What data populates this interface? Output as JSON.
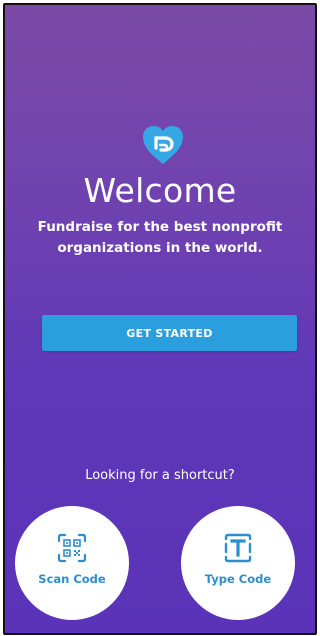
{
  "welcome": {
    "title": "Welcome",
    "subtitle_line1": "Fundraise for the best nonprofit",
    "subtitle_line2": "organizations in the world.",
    "logo_icon": "heart-logo-icon"
  },
  "cta": {
    "get_started_label": "GET STARTED",
    "color": "#2b9fde"
  },
  "shortcuts": {
    "prompt": "Looking for a shortcut?",
    "scan_label": "Scan Code",
    "scan_icon": "qr-code-icon",
    "type_label": "Type Code",
    "type_icon": "text-t-icon",
    "label_color": "#2b8fcf"
  },
  "theme": {
    "background_top": "#7b4aa6",
    "background_bottom": "#5a33b8",
    "logo_color": "#35a7e5"
  }
}
